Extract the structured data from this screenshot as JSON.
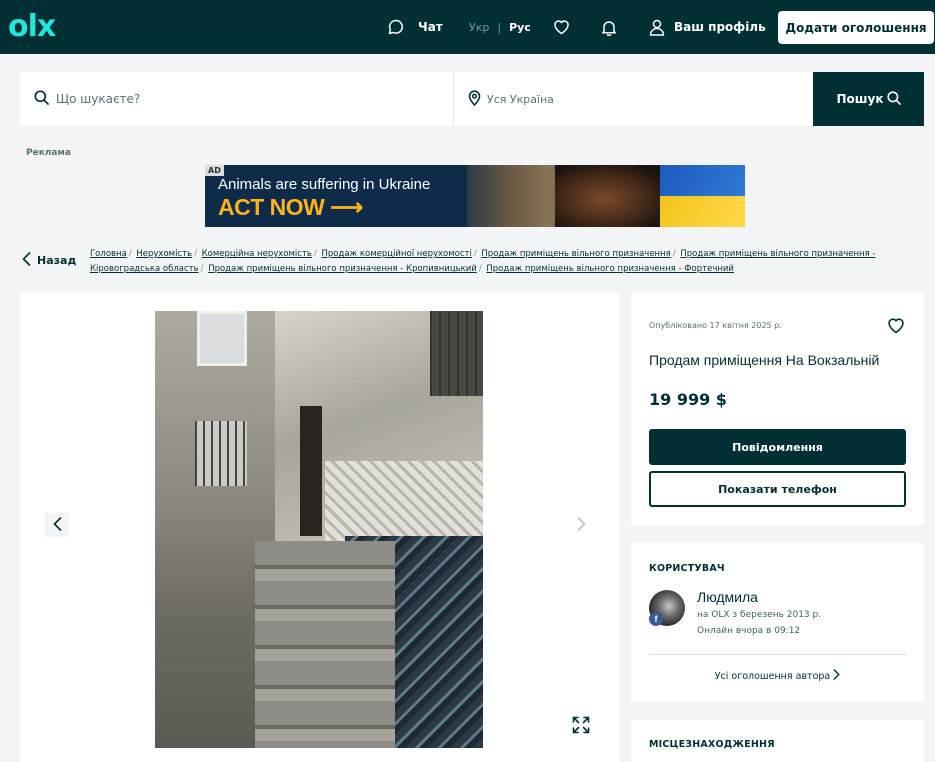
{
  "header": {
    "logo": "olx",
    "chat_label": "Чат",
    "lang_ukr": "Укр",
    "lang_sep": "|",
    "lang_rus": "Рус",
    "profile_label": "Ваш профіль",
    "add_button": "Додати оголошення",
    "colors": {
      "bg": "#002f34",
      "logo": "#23e5db"
    }
  },
  "search": {
    "query_placeholder": "Що шукаєте?",
    "location_placeholder": "Уся Україна",
    "button_label": "Пошук"
  },
  "ad": {
    "label": "Реклама",
    "tag": "AD",
    "line1": "Animals are suffering in Ukraine",
    "line2": "ACT NOW ⟶"
  },
  "breadcrumb": {
    "back_label": "Назад",
    "items": [
      "Головна",
      "Нерухомість",
      "Комерційна нерухомість",
      "Продаж комерційної нерухомості",
      "Продаж приміщень вільного призначення",
      "Продаж приміщень вільного призначення - Кіровоградська область",
      "Продаж приміщень вільного призначення - Кропивницький",
      "Продаж приміщень вільного призначення - Фортечний"
    ],
    "separator": "/"
  },
  "listing": {
    "published": "Опубліковано 17 квітня 2025 р.",
    "title": "Продам приміщення На Вокзальній",
    "price": "19 999 $",
    "message_button": "Повідомлення",
    "phone_button": "Показати телефон"
  },
  "user": {
    "section_title": "КОРИСТУВАЧ",
    "name": "Людмила",
    "since": "на OLX з березень 2013 р.",
    "online": "Онлайн вчора в 09:12",
    "fb_badge": "f",
    "all_ads": "Усі оголошення автора"
  },
  "location": {
    "section_title": "МІСЦЕЗНАХОДЖЕННЯ"
  }
}
